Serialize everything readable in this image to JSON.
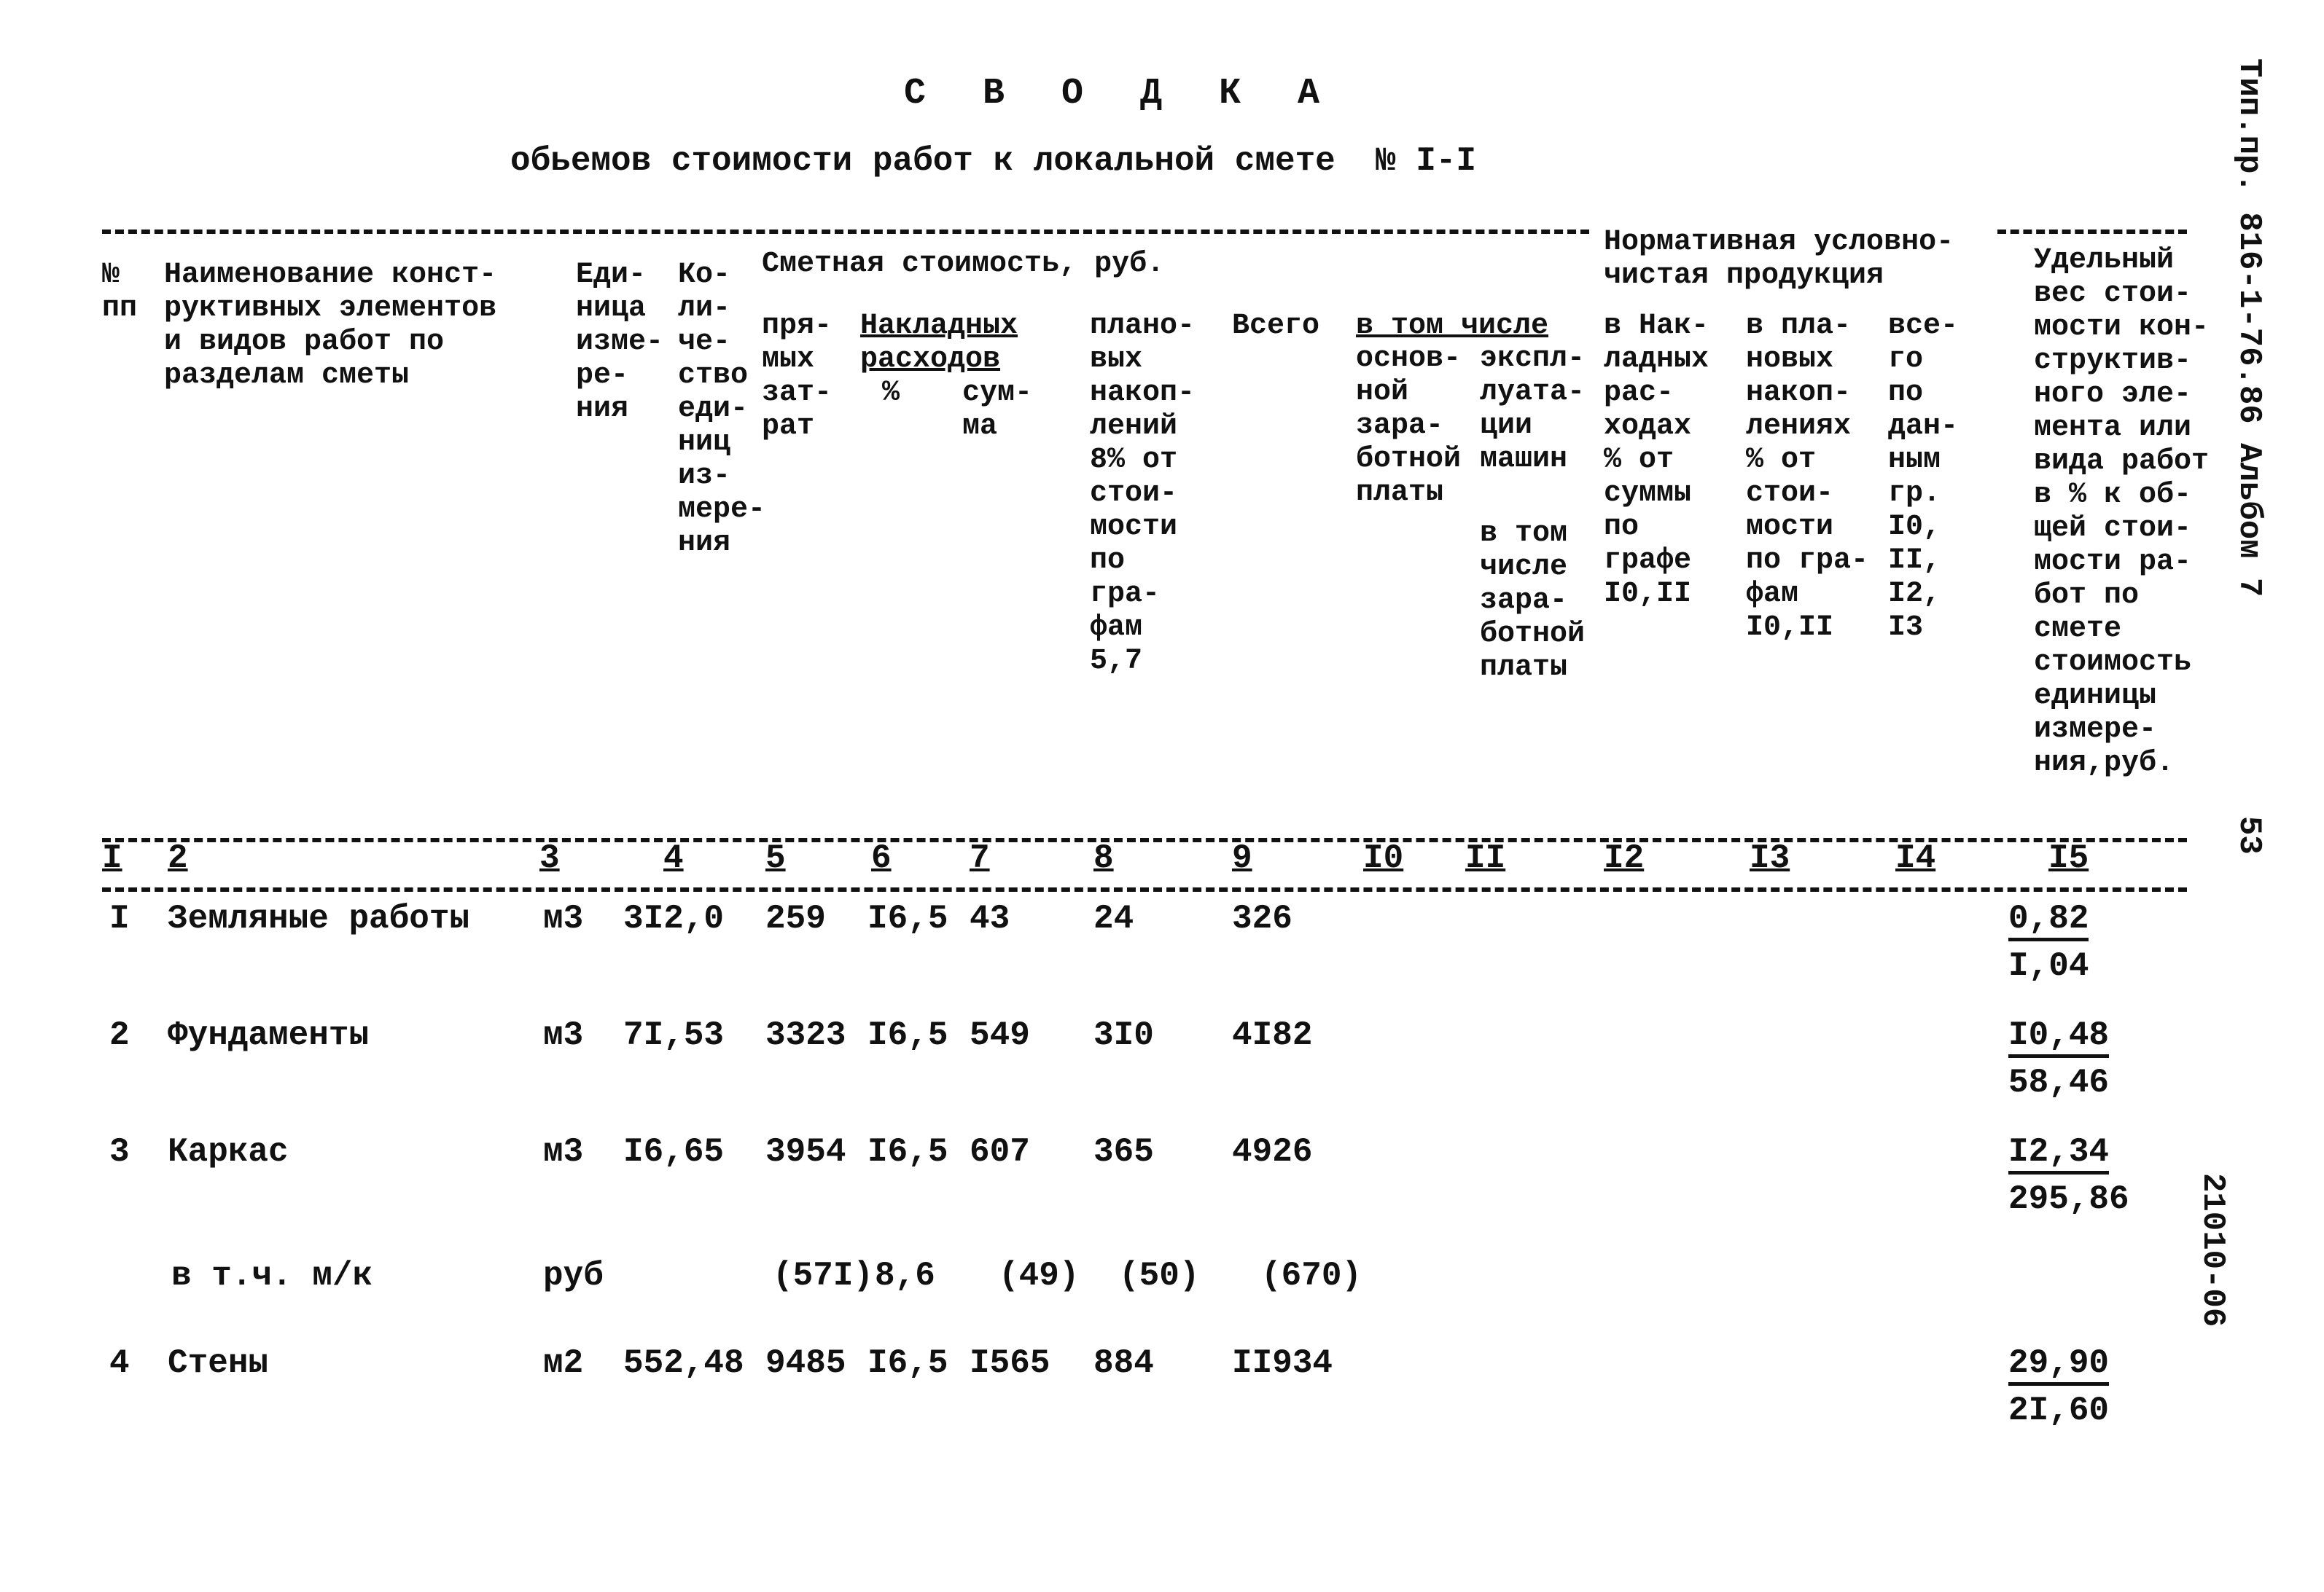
{
  "document": {
    "title": "С В О Д К А",
    "subtitle": "обьемов стоимости работ к локальной смете  № I-I",
    "side_label_top": "Тип.пр. 816-1-76.86 Альбом 7",
    "page_number": "53",
    "side_code": "21010-06"
  },
  "header": {
    "col1": [
      "№",
      "пп"
    ],
    "col2": [
      "Наименование конст-",
      "руктивных элементов",
      "и видов работ по",
      "разделам сметы"
    ],
    "col3": [
      "Еди-",
      "ница",
      "изме-",
      "ре-",
      "ния"
    ],
    "col4": [
      "Ко-",
      "ли-",
      "че-",
      "ство",
      "еди-",
      "ниц",
      "из-",
      "мере-",
      "ния"
    ],
    "group_cost": "Сметная стоимость, руб.",
    "col5": [
      "пря-",
      "мых",
      "зат-",
      "рат"
    ],
    "overhead_group": [
      "Накладных",
      "расходов"
    ],
    "col6": "%",
    "col7": [
      "сум-",
      "ма"
    ],
    "col8": [
      "плано-",
      "вых",
      "накоп-",
      "лений",
      "8% от",
      "стои-",
      "мости",
      "по",
      "гра-",
      "фам",
      "5,7"
    ],
    "col9": "Всего",
    "incl_group": "в том числе",
    "col10": [
      "основ-",
      "ной",
      "зара-",
      "ботной",
      "платы"
    ],
    "col11": [
      "экспл-",
      "луата-",
      "ции",
      "машин"
    ],
    "col11_sub": [
      "в том",
      "числе",
      "зара-",
      "ботной",
      "платы"
    ],
    "norm_group": [
      "Нормативная условно-",
      "чистая продукция"
    ],
    "col12": [
      "в Нак-",
      "ладных",
      "рас-",
      "ходах",
      "% от",
      "суммы",
      "по",
      "графе",
      "I0,II"
    ],
    "col13": [
      "в пла-",
      "новых",
      "накоп-",
      "лениях",
      "% от",
      "стои-",
      "мости",
      "по гра-",
      "фам",
      "I0,II"
    ],
    "col14": [
      "все-",
      "го",
      "по",
      "дан-",
      "ным",
      "гр.",
      "I0,",
      "II,",
      "I2,",
      "I3"
    ],
    "col15": [
      "Удельный",
      "вес стои-",
      "мости кон-",
      "структив-",
      "ного эле-",
      "мента или",
      "вида работ",
      "в % к об-",
      "щей стои-",
      "мости ра-",
      "бот по",
      "смете",
      "стоимость",
      "единицы",
      "измере-",
      "ния,руб."
    ]
  },
  "column_numbers": [
    "I",
    "2",
    "3",
    "4",
    "5",
    "6",
    "7",
    "8",
    "9",
    "I0",
    "II",
    "I2",
    "I3",
    "I4",
    "I5"
  ],
  "rows": [
    {
      "num": "I",
      "name": "Земляные работы",
      "unit": "м3",
      "qty": "3I2,0",
      "direct": "259",
      "oh_pct": "I6,5",
      "oh_sum": "43",
      "planned": "24",
      "total": "326",
      "share": "0,82",
      "unit_cost": "I,04"
    },
    {
      "num": "2",
      "name": "Фундаменты",
      "unit": "м3",
      "qty": "7I,53",
      "direct": "3323",
      "oh_pct": "I6,5",
      "oh_sum": "549",
      "planned": "3I0",
      "total": "4I82",
      "share": "I0,48",
      "unit_cost": "58,46"
    },
    {
      "num": "3",
      "name": "Каркас",
      "unit": "м3",
      "qty": "I6,65",
      "direct": "3954",
      "oh_pct": "I6,5",
      "oh_sum": "607",
      "planned": "365",
      "total": "4926",
      "share": "I2,34",
      "unit_cost": "295,86"
    },
    {
      "num": "",
      "name": "в т.ч. м/к",
      "unit": "руб",
      "qty": "",
      "direct": "(57I)",
      "oh_pct": "8,6",
      "oh_sum": "(49)",
      "planned": "(50)",
      "total": "(670)",
      "share": "",
      "unit_cost": ""
    },
    {
      "num": "4",
      "name": "Стены",
      "unit": "м2",
      "qty": "552,48",
      "direct": "9485",
      "oh_pct": "I6,5",
      "oh_sum": "I565",
      "planned": "884",
      "total": "II934",
      "share": "29,90",
      "unit_cost": "2I,60"
    }
  ]
}
